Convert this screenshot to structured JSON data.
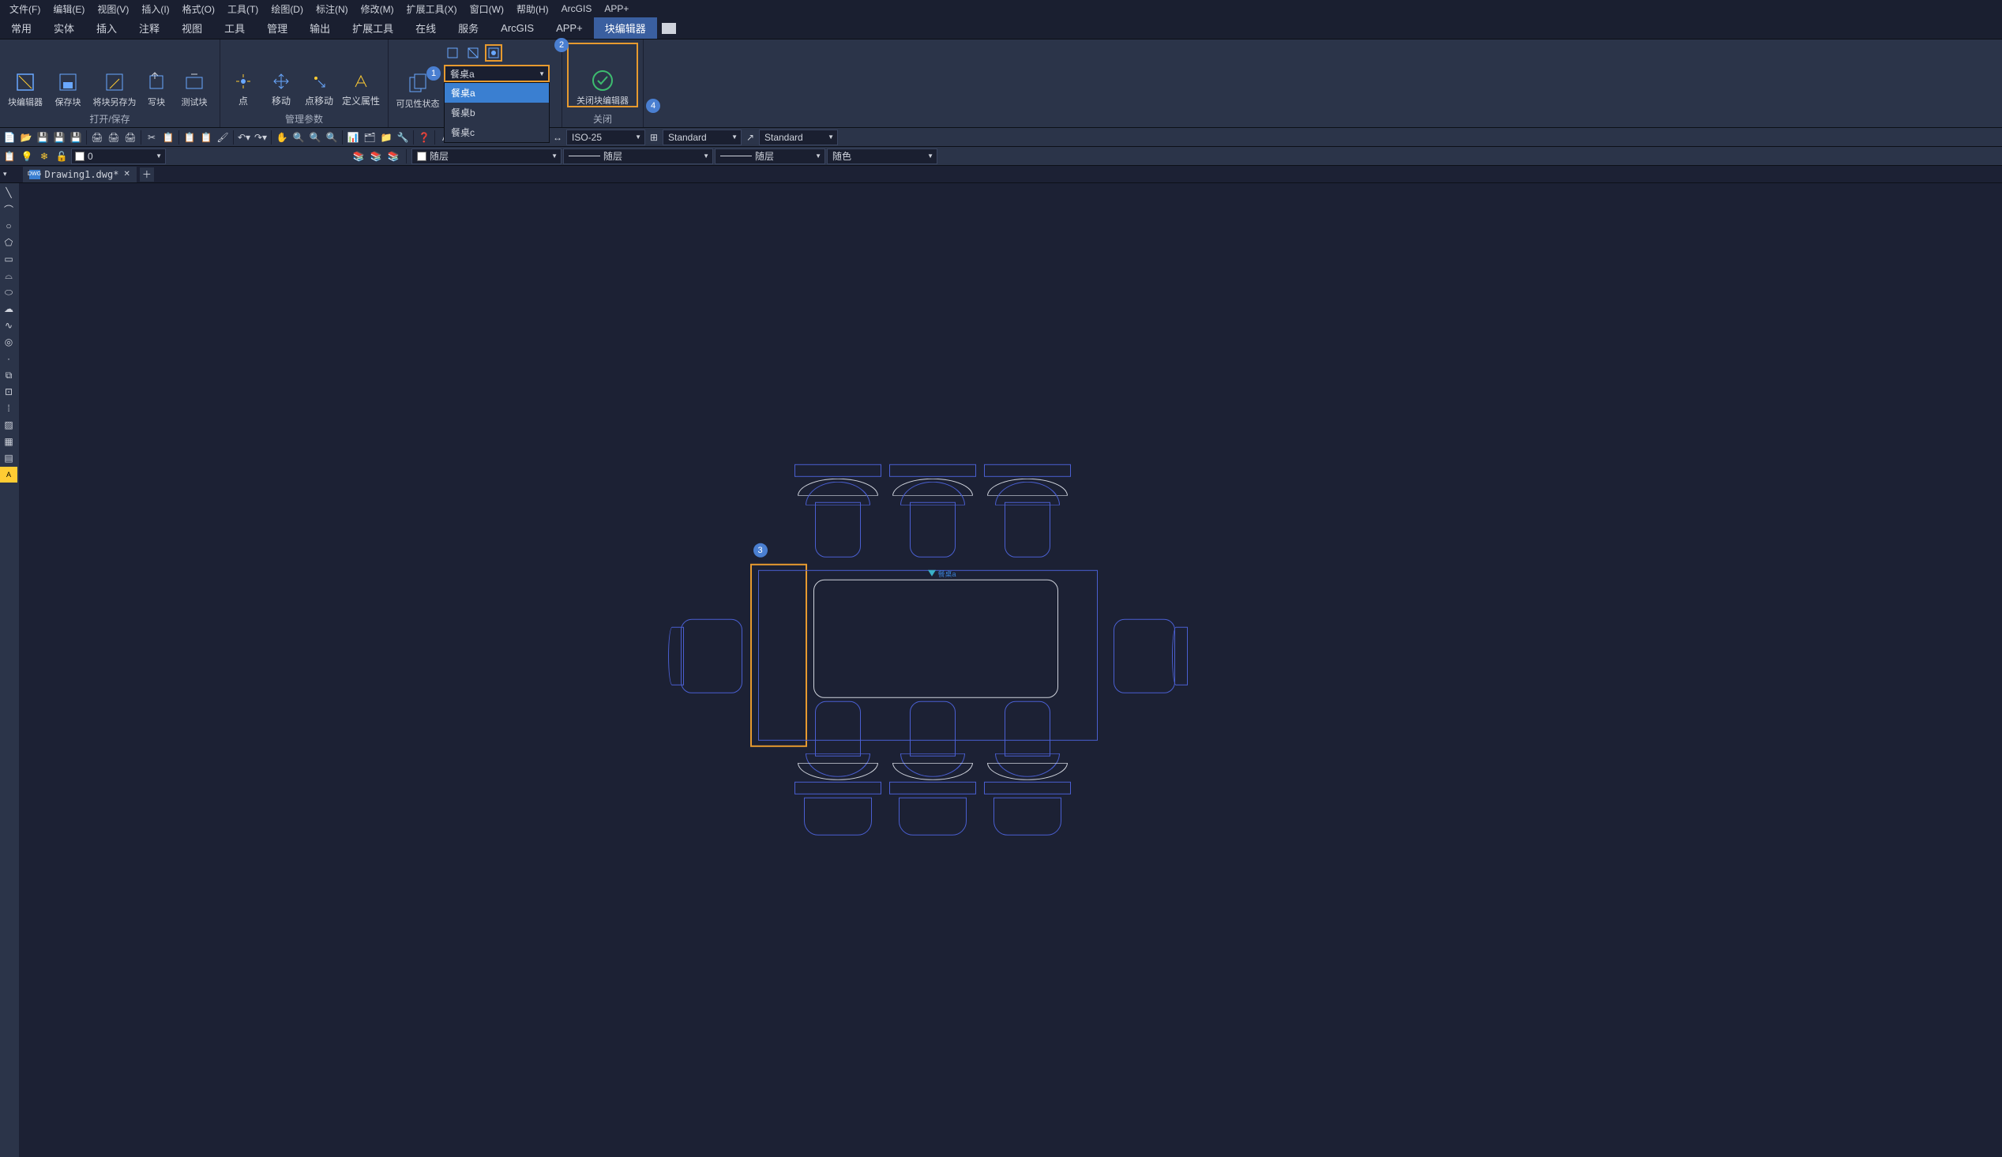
{
  "menubar": [
    "文件(F)",
    "编辑(E)",
    "视图(V)",
    "插入(I)",
    "格式(O)",
    "工具(T)",
    "绘图(D)",
    "标注(N)",
    "修改(M)",
    "扩展工具(X)",
    "窗口(W)",
    "帮助(H)",
    "ArcGIS",
    "APP+"
  ],
  "ribbon_tabs": [
    "常用",
    "实体",
    "插入",
    "注释",
    "视图",
    "工具",
    "管理",
    "输出",
    "扩展工具",
    "在线",
    "服务",
    "ArcGIS",
    "APP+",
    "块编辑器"
  ],
  "ribbon_active": "块编辑器",
  "panels": {
    "open_save": {
      "title": "打开/保存",
      "buttons": [
        "块编辑器",
        "保存块",
        "将块另存为",
        "写块",
        "测试块"
      ]
    },
    "manage": {
      "title": "管理参数",
      "buttons": [
        "点",
        "移动",
        "点移动",
        "定义属性"
      ]
    },
    "vis": {
      "title": "",
      "big": "可见性状态",
      "selected": "餐桌a",
      "options": [
        "餐桌a",
        "餐桌b",
        "餐桌c"
      ]
    },
    "close": {
      "title": "关闭",
      "button": "关闭块编辑器"
    }
  },
  "badges": {
    "b1": "1",
    "b2": "2",
    "b3": "3",
    "b4": "4"
  },
  "qat_combo1": "ISO-25",
  "qat_combo2": "Standard",
  "qat_combo3": "Standard",
  "layer_combo": "0",
  "prop": {
    "color": "随层",
    "linetype": "随层",
    "lineweight": "随层",
    "plotstyle": "随色"
  },
  "doc": {
    "name": "Drawing1.dwg*"
  },
  "grip_label": "餐桌a"
}
